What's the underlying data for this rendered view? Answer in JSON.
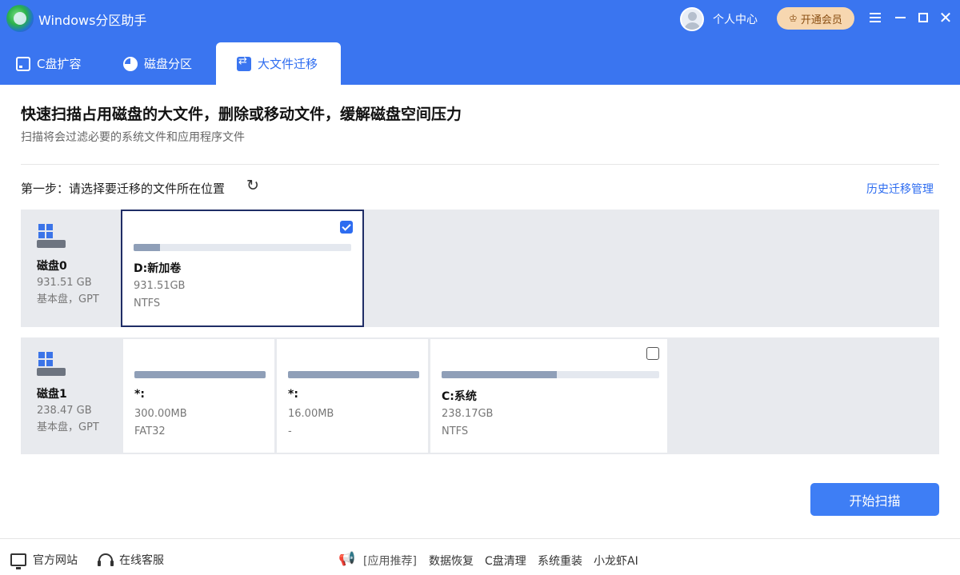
{
  "app": {
    "title": "Windows分区助手",
    "user_center": "个人中心",
    "vip_label": "开通会员",
    "vip_icon": "crown-icon",
    "window_controls": [
      "menu-icon",
      "minimize-icon",
      "maximize-icon",
      "close-icon"
    ]
  },
  "tabs": [
    {
      "label": "C盘扩容",
      "icon": "disk-icon",
      "active": false
    },
    {
      "label": "磁盘分区",
      "icon": "pie-chart-icon",
      "active": false
    },
    {
      "label": "大文件迁移",
      "icon": "file-move-icon",
      "active": true
    }
  ],
  "main": {
    "title": "快速扫描占用磁盘的大文件，删除或移动文件，缓解磁盘空间压力",
    "subtitle": "扫描将会过滤必要的系统文件和应用程序文件",
    "step_label": "第一步：请选择要迁移的文件所在位置",
    "history_link": "历史迁移管理",
    "start_button": "开始扫描"
  },
  "disks": [
    {
      "name": "磁盘0",
      "size": "931.51 GB",
      "type": "基本盘，GPT",
      "partitions": [
        {
          "name": "D:新加卷",
          "capacity": "931.51GB",
          "fs": "NTFS",
          "used_fraction": 0.12,
          "checked": true,
          "selected": true
        }
      ]
    },
    {
      "name": "磁盘1",
      "size": "238.47 GB",
      "type": "基本盘，GPT",
      "partitions": [
        {
          "name": "*:",
          "capacity": "300.00MB",
          "fs": "FAT32",
          "used_fraction": 1.0
        },
        {
          "name": "*:",
          "capacity": "16.00MB",
          "fs": "-",
          "used_fraction": 1.0
        },
        {
          "name": "C:系统",
          "capacity": "238.17GB",
          "fs": "NTFS",
          "used_fraction": 0.53,
          "checked": false
        }
      ]
    }
  ],
  "footer": {
    "site": "官方网站",
    "service": "在线客服",
    "recommend_label": "[应用推荐]",
    "apps": [
      "数据恢复",
      "C盘清理",
      "系统重装",
      "小龙虾AI"
    ]
  },
  "colors": {
    "brand_blue": "#3a75f0",
    "button_blue": "#3e7ef5",
    "selected_border": "#1f2d66",
    "vip_bg": "#f7d7b0"
  }
}
